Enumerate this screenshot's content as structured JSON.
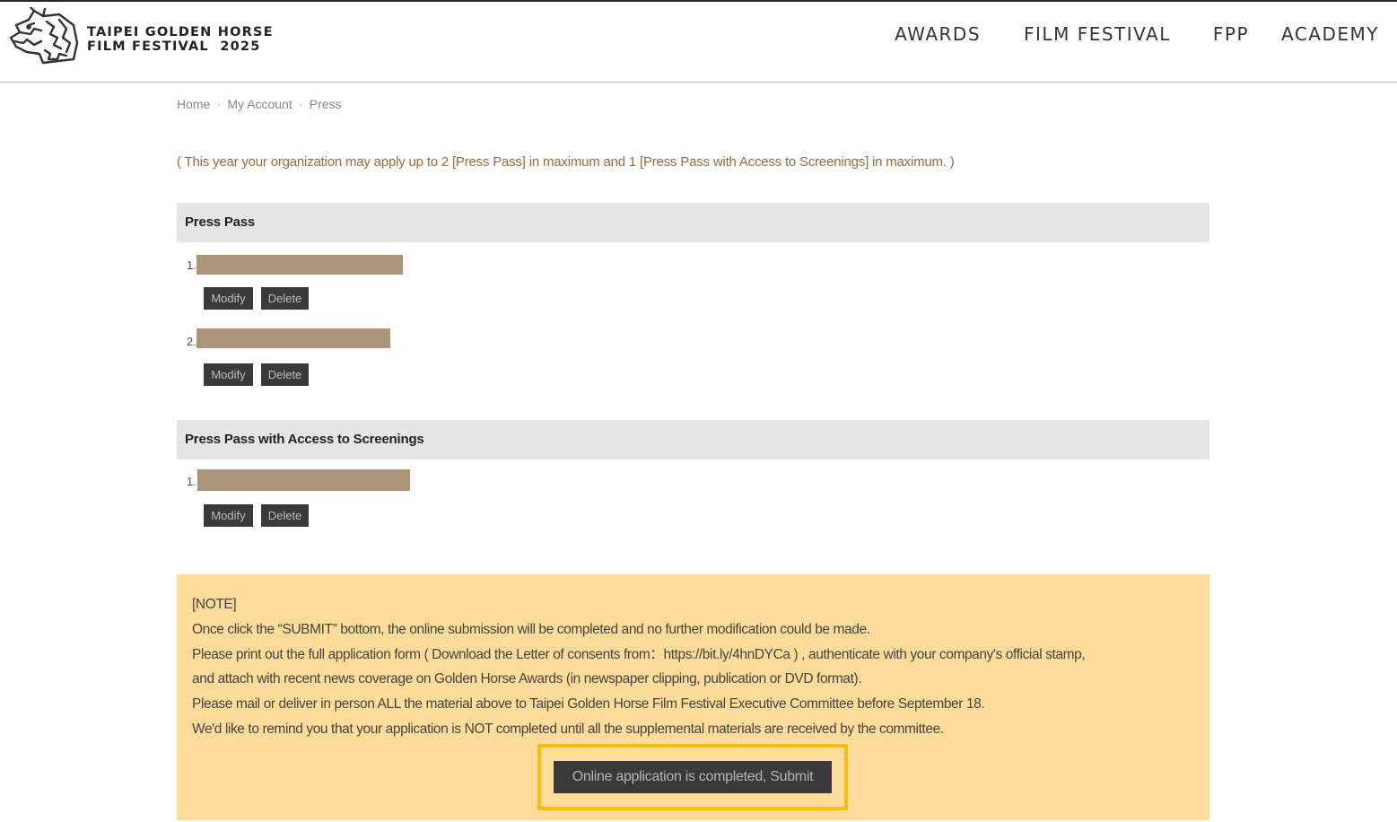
{
  "header": {
    "logo_line1": "TAIPEI GOLDEN HORSE",
    "logo_line2": "FILM FESTIVAL  2025",
    "nav": [
      "AWARDS",
      "FILM FESTIVAL",
      "FPP",
      "ACADEMY"
    ]
  },
  "breadcrumb": {
    "home": "Home",
    "account": "My Account",
    "current": "Press",
    "separator": "›"
  },
  "limit_note": "( This year your organization may apply up to 2 [Press Pass] in maximum and 1 [Press Pass with Access to Screenings] in maximum. )",
  "sections": [
    {
      "title": "Press Pass",
      "entries": [
        {
          "number": "1.",
          "modify": "Modify",
          "delete": "Delete"
        },
        {
          "number": "2.",
          "modify": "Modify",
          "delete": "Delete"
        }
      ]
    },
    {
      "title": "Press Pass with Access to Screenings",
      "entries": [
        {
          "number": "1.",
          "modify": "Modify",
          "delete": "Delete"
        }
      ]
    }
  ],
  "note": {
    "lines": [
      "[NOTE]",
      "Once click the “SUBMIT” bottom, the online submission will be completed and no further modification could be made.",
      "Please print out the full application form ( Download the Letter of consents from：https://bit.ly/4hnDYCa ) , authenticate with your company's official stamp,",
      "and attach with recent news coverage on Golden Horse Awards (in newspaper clipping, publication or DVD format).",
      "Please mail or deliver in person ALL the material above to Taipei Golden Horse Film Festival Executive Committee before September 18.",
      "We'd like to remind you that your application is NOT completed until all the supplemental materials are received by the committee."
    ],
    "submit_label": "Online application is completed, Submit"
  },
  "colors": {
    "redaction": "#ab9478",
    "note_background": "#fddc99",
    "highlight_frame": "#f6bd14",
    "button_dark": "#3a3a3a",
    "limit_note_text": "#9a6b3a"
  }
}
